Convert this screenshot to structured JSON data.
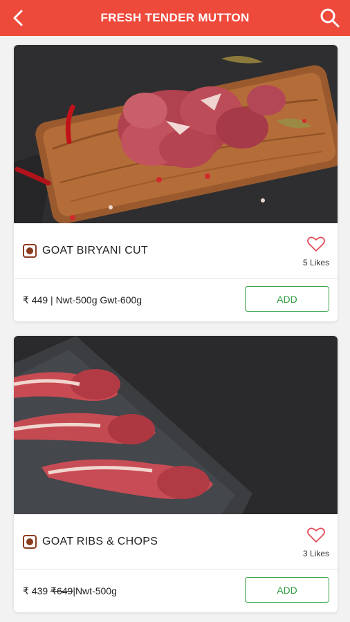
{
  "header": {
    "title": "FRESH TENDER MUTTON",
    "back_icon": "chevron-left-icon",
    "search_icon": "search-icon",
    "color": "#ee4a3c"
  },
  "products": [
    {
      "name": "GOAT BIRYANI CUT",
      "likes": "5 Likes",
      "price": "₹ 449",
      "original_price": "",
      "weight": " | Nwt-500g Gwt-600g",
      "add_label": "ADD"
    },
    {
      "name": "GOAT RIBS & CHOPS",
      "likes": "3 Likes",
      "price": "₹ 439",
      "original_price": "₹649",
      "weight": "|Nwt-500g",
      "add_label": "ADD"
    }
  ]
}
